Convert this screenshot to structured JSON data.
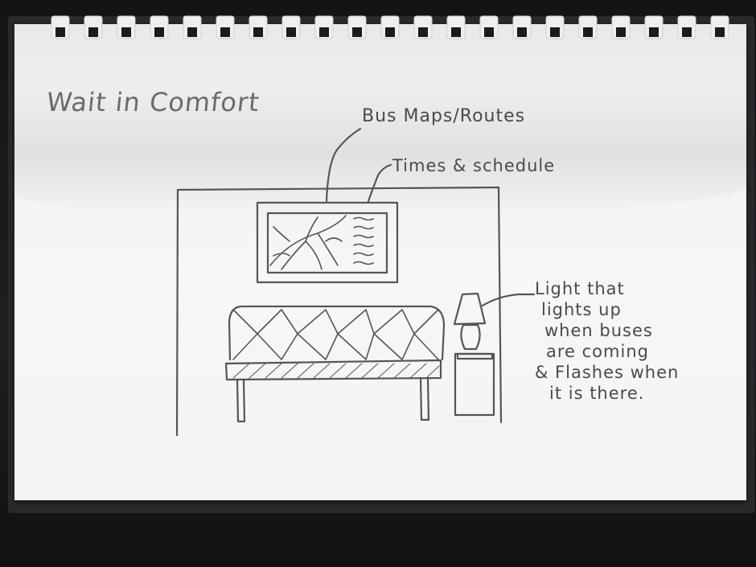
{
  "sketch": {
    "title": "Wait in Comfort",
    "labels": {
      "bus_maps": "Bus Maps/Routes",
      "times": "Times & schedule",
      "light": [
        "Light that",
        "lights up",
        "when buses",
        "are coming",
        "& Flashes when",
        "it is there."
      ]
    }
  },
  "colors": {
    "paper": "#f4f4f5",
    "pencil": "#4a4a4c",
    "background": "#1b1a1e"
  }
}
